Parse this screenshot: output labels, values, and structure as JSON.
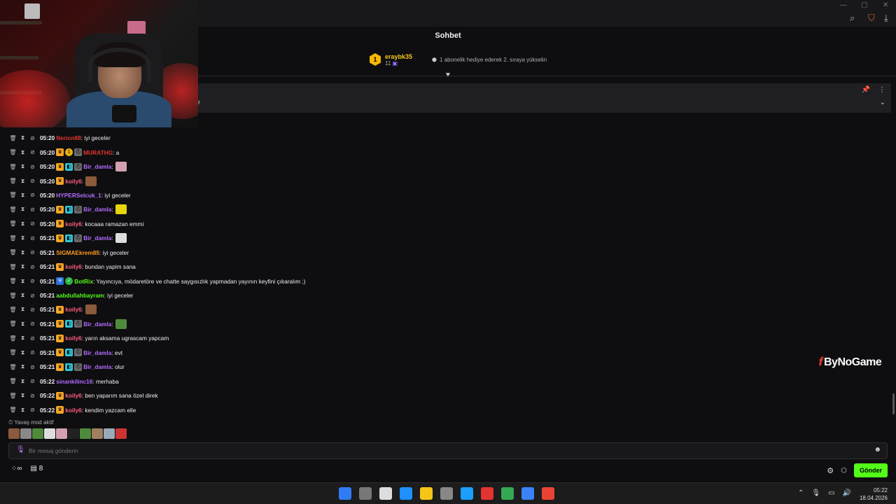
{
  "chat": {
    "title": "Sohbet",
    "leader": {
      "rank": "1",
      "name": "eraybk35",
      "count": "11",
      "hint": "1 abonelik hediye ederek 2. sıraya yükselin"
    },
    "pinned_fragment": "r",
    "messages": [
      {
        "time": "05:20",
        "user": "Nerion88",
        "color": "#e3342f",
        "badges": [],
        "text": ": iyi geceler",
        "emote": null
      },
      {
        "time": "05:20",
        "user": "MURATHG",
        "color": "#e3342f",
        "badges": [
          "crown",
          "coin",
          "hat"
        ],
        "text": ": a",
        "emote": null
      },
      {
        "time": "05:20",
        "user": "Bir_damla",
        "color": "#b36bff",
        "badges": [
          "crown",
          "blue",
          "hat"
        ],
        "text": ":",
        "emote": "#d4a0b0"
      },
      {
        "time": "05:20",
        "user": "koily6",
        "color": "#ff5e7a",
        "badges": [
          "crown"
        ],
        "text": ":",
        "emote": "#8a5a3c"
      },
      {
        "time": "05:20",
        "user": "HYPERSelcuk_1",
        "color": "#b36bff",
        "badges": [],
        "text": ": iyi geceler",
        "emote": null
      },
      {
        "time": "05:20",
        "user": "Bir_damla",
        "color": "#b36bff",
        "badges": [
          "crown",
          "blue",
          "hat"
        ],
        "text": ":",
        "emote": "#e8d40a"
      },
      {
        "time": "05:20",
        "user": "koily6",
        "color": "#ff5e7a",
        "badges": [
          "crown"
        ],
        "text": ": kocaaa ramazan emmi",
        "emote": null
      },
      {
        "time": "05:21",
        "user": "Bir_damla",
        "color": "#b36bff",
        "badges": [
          "crown",
          "blue",
          "hat"
        ],
        "text": ":",
        "emote": "#dddddd"
      },
      {
        "time": "05:21",
        "user": "SIGMAEkrem85",
        "color": "#ff9a1f",
        "badges": [],
        "text": ": iyi geceler",
        "emote": null
      },
      {
        "time": "05:21",
        "user": "koily6",
        "color": "#ff5e7a",
        "badges": [
          "crown"
        ],
        "text": ": bundan yapim sana",
        "emote": null
      },
      {
        "time": "05:21",
        "user": "BotRix",
        "color": "#53fc18",
        "badges": [
          "shield",
          "check"
        ],
        "text": ": Yayıncıya, mödaretöre ve chatte saygısızlık yapmadan yayının keyfini çıkaralım ;)",
        "emote": null
      },
      {
        "time": "05:21",
        "user": "aabdullahbayram",
        "color": "#53fc18",
        "badges": [],
        "text": ": iyi geceler",
        "emote": null
      },
      {
        "time": "05:21",
        "user": "koily6",
        "color": "#ff5e7a",
        "badges": [
          "crown"
        ],
        "text": ":",
        "emote": "#8a5a3c"
      },
      {
        "time": "05:21",
        "user": "Bir_damla",
        "color": "#b36bff",
        "badges": [
          "crown",
          "blue",
          "hat"
        ],
        "text": ":",
        "emote": "#4f8a3c"
      },
      {
        "time": "05:21",
        "user": "koily6",
        "color": "#ff5e7a",
        "badges": [
          "crown"
        ],
        "text": ": yarın aksama ugrascam yapcam",
        "emote": null
      },
      {
        "time": "05:21",
        "user": "Bir_damla",
        "color": "#b36bff",
        "badges": [
          "crown",
          "blue",
          "hat"
        ],
        "text": ": evt",
        "emote": null
      },
      {
        "time": "05:21",
        "user": "Bir_damla",
        "color": "#b36bff",
        "badges": [
          "crown",
          "blue",
          "hat"
        ],
        "text": ": olur",
        "emote": null
      },
      {
        "time": "05:22",
        "user": "sinankilinc16",
        "color": "#b36bff",
        "badges": [],
        "text": ": merhaba",
        "emote": null
      },
      {
        "time": "05:22",
        "user": "koily6",
        "color": "#ff5e7a",
        "badges": [
          "crown"
        ],
        "text": ": ben yaparım sana özel direk",
        "emote": null
      },
      {
        "time": "05:22",
        "user": "koily6",
        "color": "#ff5e7a",
        "badges": [
          "crown"
        ],
        "text": ": kendim yazcam elle",
        "emote": null
      }
    ],
    "slow_mode": "Yavaş mod aktif",
    "emote_bar_colors": [
      "#8a5a3c",
      "#888",
      "#4f8a3c",
      "#ddd",
      "#d4a0b0",
      "#222",
      "#4f8a3c",
      "#a08060",
      "#9ab",
      "#c33"
    ],
    "input": {
      "placeholder": "Bir mesaj gönderin"
    },
    "bottom_count": "8",
    "send_label": "Gönder"
  },
  "watermark": "ByNoGame",
  "taskbar": {
    "time": "05:22",
    "date": "18.04.2026",
    "app_colors": [
      "#2f7bf5",
      "#777",
      "#ddd",
      "#1e90ff",
      "#f5c518",
      "#888",
      "#1a9fff",
      "#e3342f",
      "#34a853",
      "#3b82f6",
      "#ea4335"
    ]
  }
}
